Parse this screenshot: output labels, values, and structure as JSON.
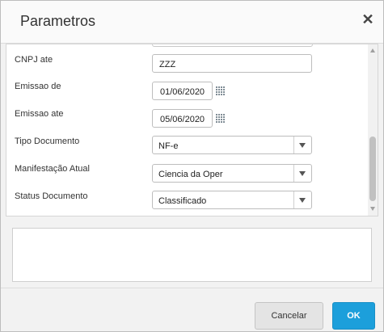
{
  "dialog": {
    "title": "Parametros",
    "close_glyph": "✕"
  },
  "form": {
    "cnpj_ate": {
      "label": "CNPJ ate",
      "value": "ZZZ"
    },
    "emissao_de": {
      "label": "Emissao de",
      "value": "01/06/2020",
      "icon": "calendar-icon"
    },
    "emissao_ate": {
      "label": "Emissao ate",
      "value": "05/06/2020",
      "icon": "calendar-icon"
    },
    "tipo_documento": {
      "label": "Tipo Documento",
      "selected": "NF-e"
    },
    "manifestacao_atual": {
      "label": "Manifestação Atual",
      "selected": "Ciencia da Oper"
    },
    "status_documento": {
      "label": "Status Documento",
      "selected": "Classificado"
    }
  },
  "scroll": {
    "position_fraction": 0.58
  },
  "notes": {
    "value": ""
  },
  "buttons": {
    "cancel_label": "Cancelar",
    "ok_label": "OK"
  },
  "colors": {
    "accent": "#1c9fdb",
    "background": "#f2f2f2"
  }
}
